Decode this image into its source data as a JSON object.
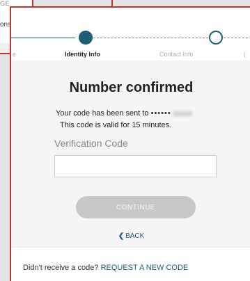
{
  "background": {
    "heading_fragment": "GE",
    "text_fragment": "ons"
  },
  "stepper": {
    "steps": [
      {
        "label": "e",
        "state": "done"
      },
      {
        "label": "Identity Info",
        "state": "current"
      },
      {
        "label": "Contact Info",
        "state": "upcoming"
      },
      {
        "label": "(",
        "state": "upcoming"
      }
    ]
  },
  "verify": {
    "title": "Number confirmed",
    "sent_prefix": "Your code has been sent to",
    "masked_number": "••••••",
    "validity": "This code is valid for 15 minutes.",
    "code_label": "Verification Code",
    "code_value": "",
    "code_placeholder": "",
    "continue_label": "CONTINUE",
    "back_label": "BACK"
  },
  "footer": {
    "prompt": "Didn't receive a code?",
    "request_label": "REQUEST A NEW CODE"
  },
  "colors": {
    "accent": "#1e5e72",
    "frame": "#b8392f",
    "disabled_button": "#c8c8c8"
  }
}
